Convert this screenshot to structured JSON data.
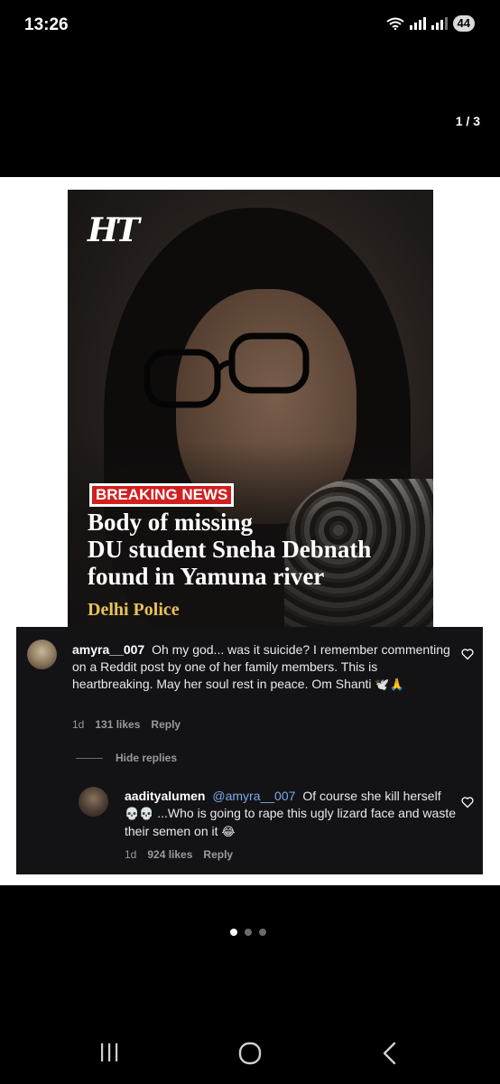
{
  "status_bar": {
    "time": "13:26",
    "battery": "44",
    "icons": [
      "wifi-icon",
      "signal-icon",
      "signal-icon-2",
      "battery-icon"
    ]
  },
  "viewer": {
    "counter": "1 / 3",
    "dots": {
      "total": 3,
      "active": 1
    }
  },
  "news_card": {
    "logo": "HT",
    "badge": "BREAKING NEWS",
    "headline_lines": [
      "Body of missing",
      "DU student Sneha Debnath",
      "found in Yamuna river"
    ],
    "source": "Delhi Police",
    "colors": {
      "badge": "#d21f1f",
      "source": "#e7c25a"
    }
  },
  "comments": {
    "first": {
      "username": "amyra__007",
      "text": "Oh my god... was it suicide? I remember commenting on a Reddit post by one of her family members. This is heartbreaking. May her soul rest in peace. Om Shanti",
      "emoji": "🕊️🙏",
      "age": "1d",
      "likes": "131 likes",
      "reply_label": "Reply"
    },
    "hide_replies_label": "Hide replies",
    "reply": {
      "username": "aadityalumen",
      "mention": "@amyra__007",
      "text_a": "Of course she kill herself",
      "emoji_a": "💀💀",
      "text_b": "...Who is going to rape this ugly lizard face and waste their semen on it",
      "emoji_b": "😂",
      "age": "1d",
      "likes": "924 likes",
      "reply_label": "Reply"
    }
  },
  "nav": [
    "recent-apps-icon",
    "home-icon",
    "back-icon"
  ]
}
